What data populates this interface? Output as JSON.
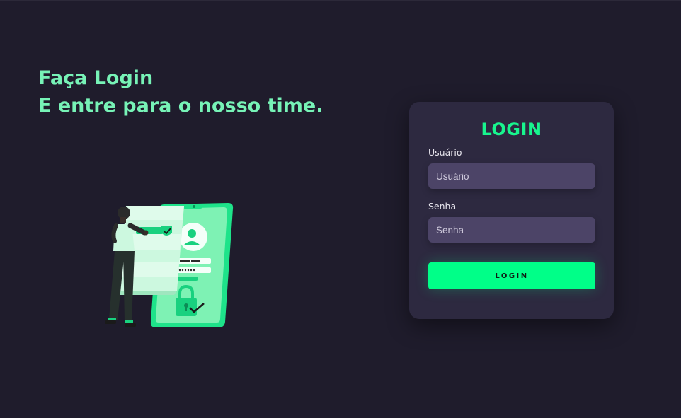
{
  "hero": {
    "line1": "Faça Login",
    "line2": "E entre para o nosso time."
  },
  "login_card": {
    "title": "LOGIN",
    "username": {
      "label": "Usuário",
      "placeholder": "Usuário",
      "value": ""
    },
    "password": {
      "label": "Senha",
      "placeholder": "Senha",
      "value": ""
    },
    "submit_label": "LOGIN"
  },
  "colors": {
    "background": "#1f1c2c",
    "card": "#2d2940",
    "accent": "#00ff88",
    "hero_text": "#77f3b7",
    "input": "#4c4467"
  },
  "icons": [
    "login-illustration",
    "user-avatar-icon",
    "lock-icon",
    "check-icon",
    "shield-icon"
  ]
}
